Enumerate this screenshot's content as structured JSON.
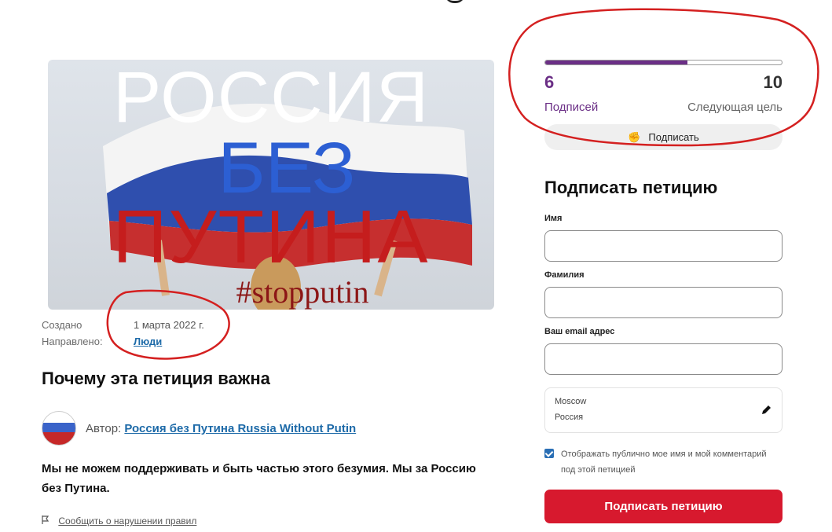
{
  "hero": {
    "line1": "РОССИЯ",
    "line2": "БЕЗ",
    "line3": "ПУТИНА",
    "line4": "#stopputin"
  },
  "meta": {
    "created_label": "Создано",
    "created_value": "1 марта 2022 г.",
    "directed_label": "Направлено:",
    "directed_value": "Люди"
  },
  "section": {
    "title": "Почему эта петиция важна"
  },
  "author": {
    "prefix": "Автор:",
    "name": "Россия без Путина Russia Without Putin"
  },
  "body": {
    "text": "Мы не можем поддерживать и быть частью этого безумия. Мы за Россию без Путина."
  },
  "report": {
    "label": "Сообщить о нарушении правил",
    "icon": "flag-icon"
  },
  "progress": {
    "signatures": "6",
    "goal": "10",
    "signatures_label": "Подписей",
    "goal_label": "Следующая цель",
    "fill_fraction": 0.6,
    "color": "#6b2f86"
  },
  "sign_small": {
    "label": "Подписать",
    "icon": "hand-icon"
  },
  "form": {
    "title": "Подписать петицию",
    "first_name_label": "Имя",
    "last_name_label": "Фамилия",
    "email_label": "Ваш email адрес",
    "first_name_value": "",
    "last_name_value": "",
    "email_value": "",
    "location_city": "Moscow",
    "location_country": "Россия",
    "consent_checked": true,
    "consent_text": "Отображать публично мое имя и мой комментарий под этой петицией",
    "submit_label": "Подписать петицию",
    "submit_color": "#d7192e"
  },
  "annotation_color": "#d42020"
}
